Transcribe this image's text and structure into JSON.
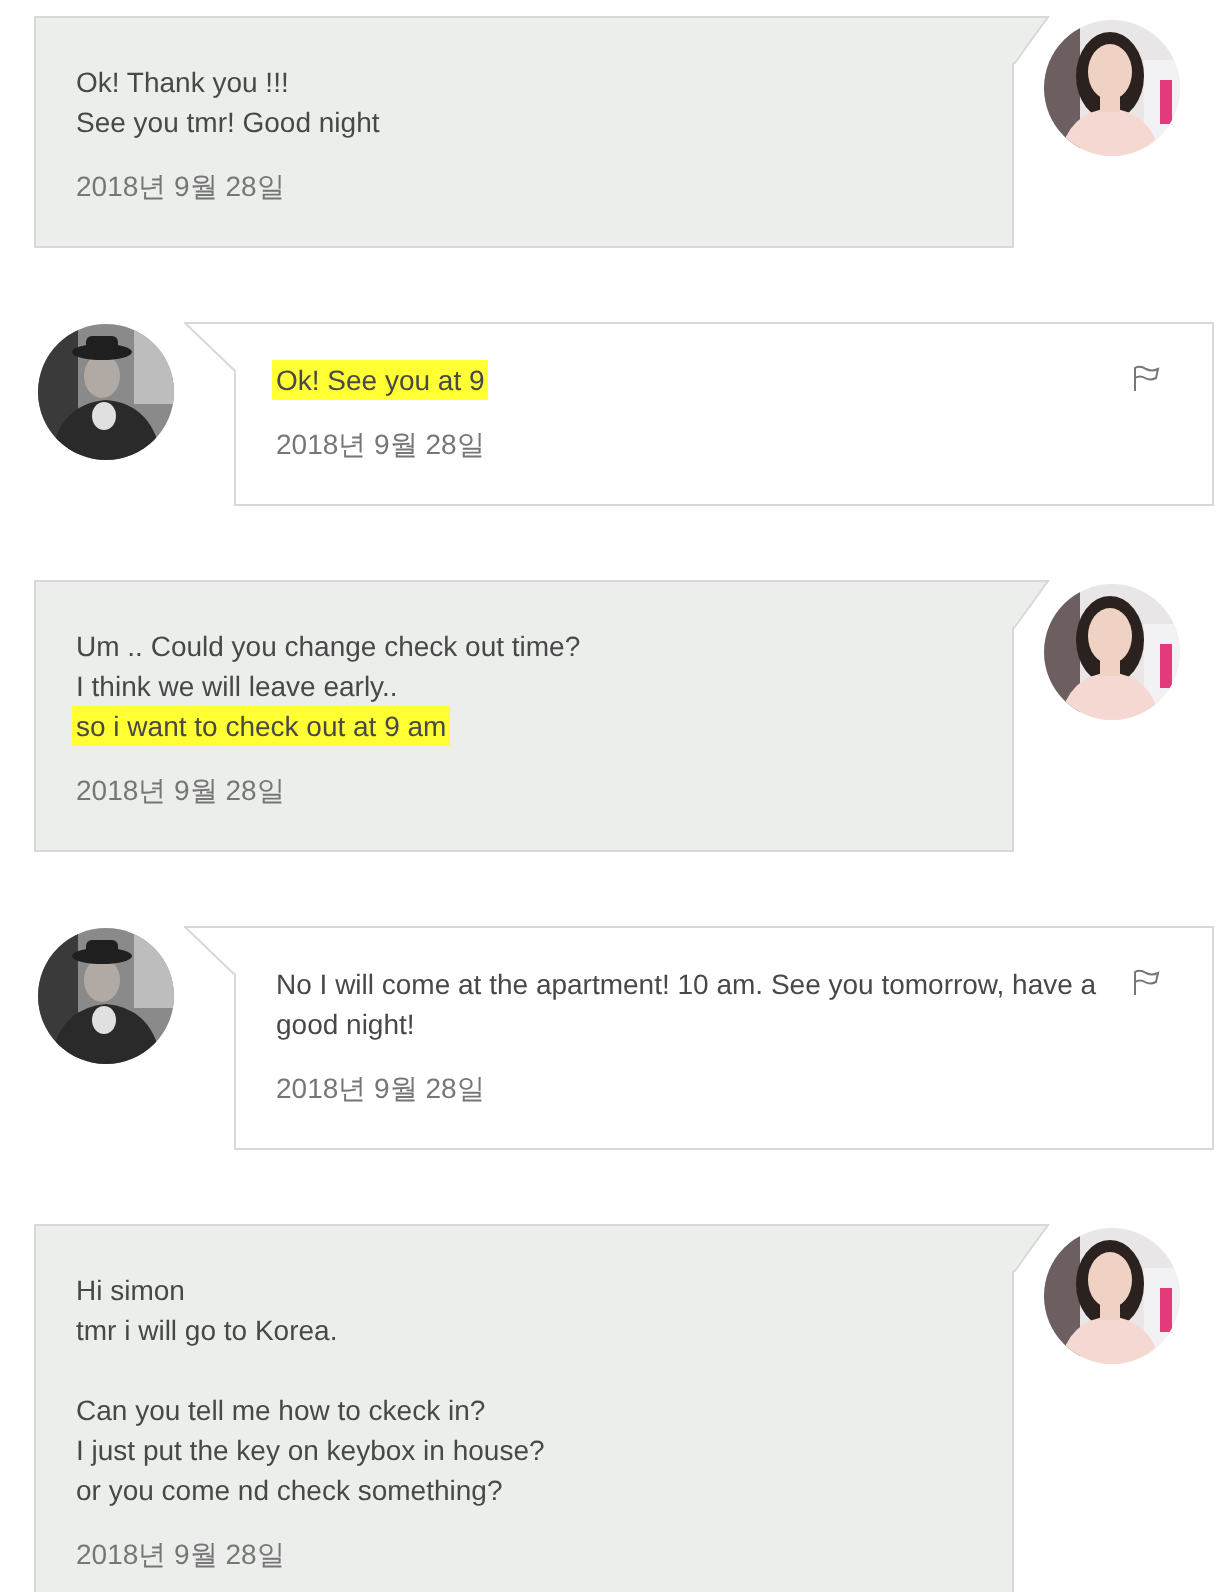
{
  "messages": [
    {
      "kind": "received",
      "paragraphs": [
        [
          {
            "text": "Ok! Thank you !!!",
            "highlighted": false
          },
          {
            "text": "See you tmr! Good night",
            "highlighted": false
          }
        ]
      ],
      "date": "2018년 9월 28일"
    },
    {
      "kind": "sent",
      "paragraphs": [
        [
          {
            "text": "Ok! See you at 9",
            "highlighted": true
          }
        ]
      ],
      "date": "2018년 9월 28일"
    },
    {
      "kind": "received",
      "paragraphs": [
        [
          {
            "text": "Um .. Could you change check out time?",
            "highlighted": false
          },
          {
            "text": "I think we will leave early..",
            "highlighted": false
          },
          {
            "text": "so i want to check out at 9 am",
            "highlighted": true
          }
        ]
      ],
      "date": "2018년 9월 28일"
    },
    {
      "kind": "sent",
      "paragraphs": [
        [
          {
            "text": "No I will come at the apartment! 10 am. See you tomorrow, have a good night!",
            "highlighted": false
          }
        ]
      ],
      "date": "2018년 9월 28일"
    },
    {
      "kind": "received",
      "paragraphs": [
        [
          {
            "text": "Hi simon",
            "highlighted": false
          },
          {
            "text": "tmr i will go to Korea.",
            "highlighted": false
          }
        ],
        [
          {
            "text": "Can you tell me how to ckeck in?",
            "highlighted": false
          },
          {
            "text": "I just put the key on keybox in house?",
            "highlighted": false
          },
          {
            "text": "or you come nd check something?",
            "highlighted": false
          }
        ]
      ],
      "date": "2018년 9월 28일"
    }
  ]
}
